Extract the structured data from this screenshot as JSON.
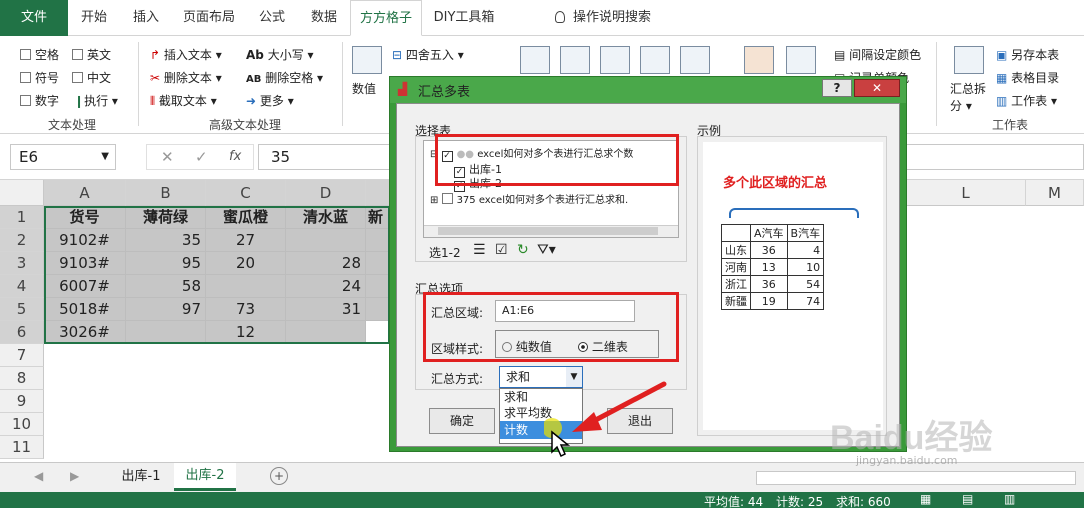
{
  "tabs": {
    "file": "文件",
    "home": "开始",
    "insert": "插入",
    "layout": "页面布局",
    "formula": "公式",
    "data": "数据",
    "ffgz": "方方格子",
    "diy": "DIY工具箱",
    "help": "操作说明搜索"
  },
  "ribbon": {
    "cb_space": "空格",
    "cb_en": "英文",
    "cb_sym": "符号",
    "cb_cn": "中文",
    "cb_num": "数字",
    "exec": "执行",
    "grp_text": "文本处理",
    "ins_text": "插入文本",
    "del_text": "删除文本",
    "cut_text": "截取文本",
    "case": "大小写",
    "del_space": "删除空格",
    "more": "更多",
    "grp_adv": "高级文本处理",
    "round": "四舍五入",
    "numval": "数值",
    "interval_color": "间隔设定颜色",
    "record_color": "记录单颜色",
    "summary_split": "汇总拆分",
    "save_table": "另存本表",
    "table_dir": "表格目录",
    "sheet": "工作表",
    "grp_sheet": "工作表"
  },
  "formula_bar": {
    "name_box": "E6",
    "fx": "fx",
    "value": "35"
  },
  "columns": [
    "A",
    "B",
    "C",
    "D",
    "L",
    "M"
  ],
  "rows": [
    "1",
    "2",
    "3",
    "4",
    "5",
    "6",
    "7",
    "8",
    "9",
    "10",
    "11"
  ],
  "table": {
    "headers": [
      "货号",
      "薄荷绿",
      "蜜瓜橙",
      "清水蓝",
      "新"
    ],
    "data": [
      [
        "9102#",
        "35",
        "27",
        "",
        ""
      ],
      [
        "9103#",
        "95",
        "20",
        "28",
        ""
      ],
      [
        "6007#",
        "58",
        "",
        "24",
        ""
      ],
      [
        "5018#",
        "97",
        "73",
        "31",
        ""
      ],
      [
        "3026#",
        "",
        "12",
        "",
        ""
      ]
    ]
  },
  "sheets": {
    "s1": "出库-1",
    "s2": "出库-2"
  },
  "status": {
    "avg": "平均值: 44",
    "count": "计数: 25",
    "sum": "求和: 660"
  },
  "dialog": {
    "title": "汇总多表",
    "help": "?",
    "select_table": "选择表",
    "tree": [
      "excel如何对多个表进行汇总求个数",
      "出库-1",
      "出库-2",
      "375 excel如何对多个表进行汇总求和."
    ],
    "select_count": "选1-2",
    "example": "示例",
    "example_title": "多个此区域的汇总",
    "example_table": {
      "headers": [
        "",
        "A汽车",
        "B汽车"
      ],
      "rows": [
        [
          "山东",
          "36",
          "4"
        ],
        [
          "河南",
          "13",
          "10"
        ],
        [
          "浙江",
          "36",
          "54"
        ],
        [
          "新疆",
          "19",
          "74"
        ]
      ]
    },
    "options": "汇总选项",
    "range_label": "汇总区域:",
    "range_value": "A1:E6",
    "style_label": "区域样式:",
    "style_opt1": "纯数值",
    "style_opt2": "二维表",
    "method_label": "汇总方式:",
    "method_value": "求和",
    "dropdown": [
      "求和",
      "求平均数",
      "计数"
    ],
    "ok": "确定",
    "exit": "退出"
  },
  "watermark": {
    "brand": "Baidu经验",
    "url": "jingyan.baidu.com"
  },
  "colors": {
    "excel_green": "#217346",
    "red": "#e02020",
    "selection": "#c6c6c6",
    "dialog_green": "#3a9a3a"
  }
}
